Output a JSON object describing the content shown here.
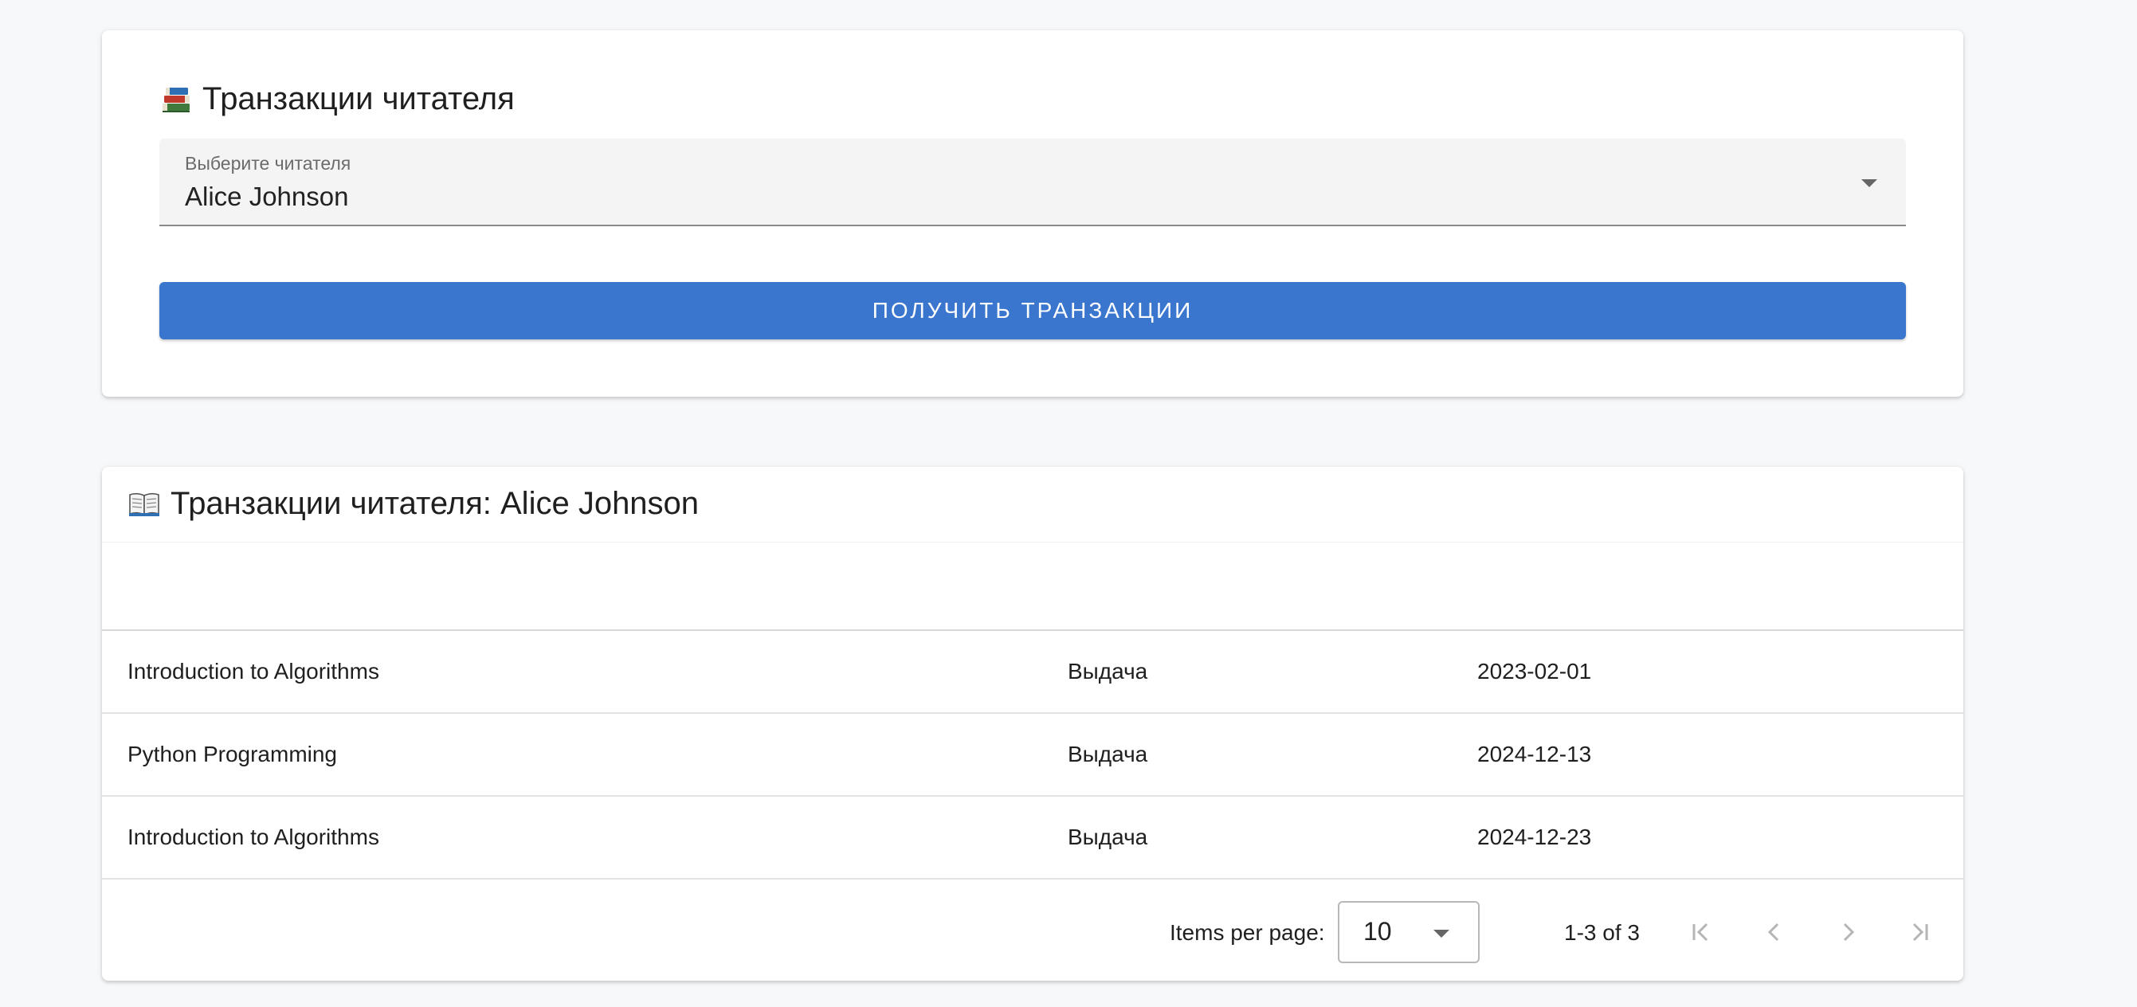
{
  "selection_card": {
    "title_icon": "books-icon",
    "title": "Транзакции читателя",
    "select_label": "Выберите читателя",
    "select_value": "Alice Johnson",
    "button_label": "ПОЛУЧИТЬ ТРАНЗАКЦИИ"
  },
  "results_card": {
    "title_icon": "open-book-icon",
    "title": "Транзакции читателя: Alice Johnson",
    "rows": [
      {
        "book": "Introduction to Algorithms",
        "type": "Выдача",
        "date": "2023-02-01"
      },
      {
        "book": "Python Programming",
        "type": "Выдача",
        "date": "2024-12-13"
      },
      {
        "book": "Introduction to Algorithms",
        "type": "Выдача",
        "date": "2024-12-23"
      }
    ],
    "pagination": {
      "items_per_page_label": "Items per page:",
      "items_per_page_value": "10",
      "range_text": "1-3 of 3",
      "first_page_icon": "first-page-icon",
      "prev_page_icon": "chevron-left-icon",
      "next_page_icon": "chevron-right-icon",
      "last_page_icon": "last-page-icon"
    }
  },
  "colors": {
    "accent": "#3a76cd",
    "background": "#f7f8fa",
    "card": "#ffffff"
  }
}
